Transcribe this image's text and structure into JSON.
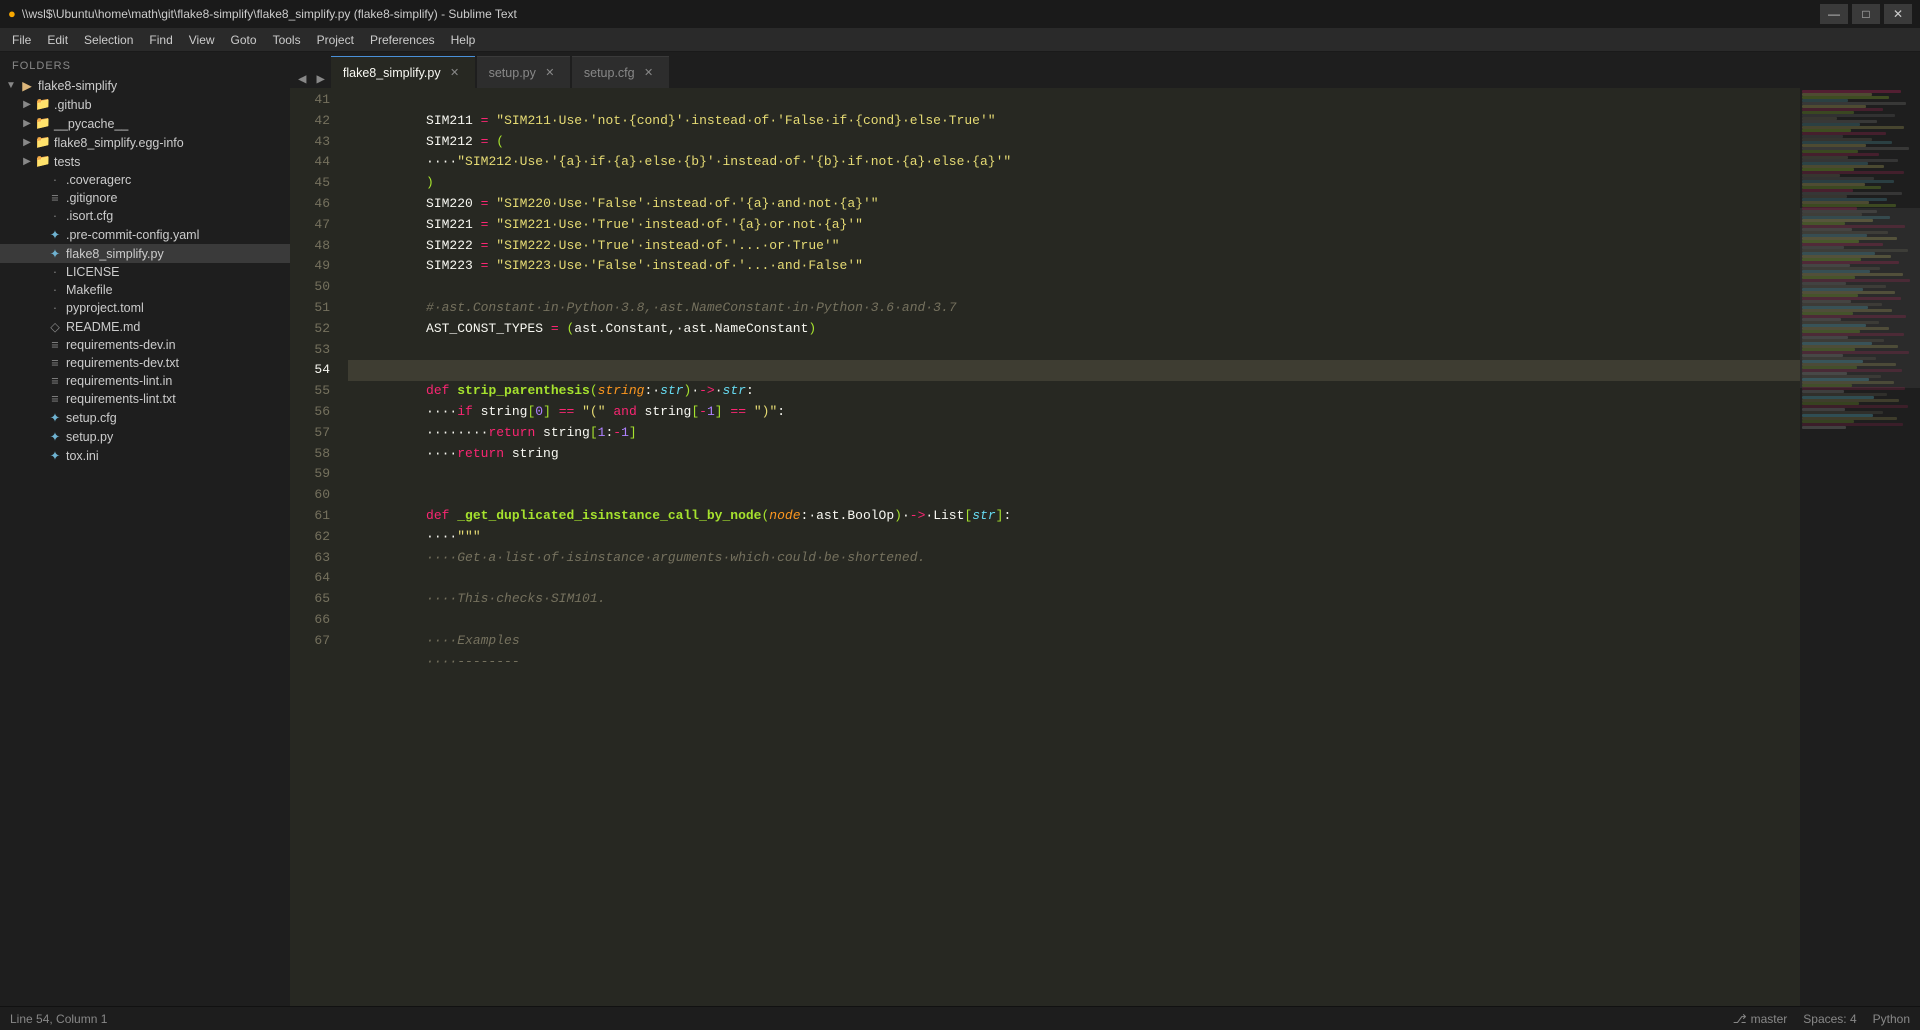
{
  "titlebar": {
    "title": "\\\\wsl$\\Ubuntu\\home\\math\\git\\flake8-simplify\\flake8_simplify.py (flake8-simplify) - Sublime Text",
    "icon": "ST",
    "minimize": "—",
    "maximize": "□",
    "close": "✕"
  },
  "menubar": {
    "items": [
      "File",
      "Edit",
      "Selection",
      "Find",
      "View",
      "Goto",
      "Tools",
      "Project",
      "Preferences",
      "Help"
    ]
  },
  "sidebar": {
    "folders_label": "FOLDERS",
    "items": [
      {
        "id": "flake8-simplify",
        "label": "flake8-simplify",
        "indent": 0,
        "type": "folder",
        "open": true,
        "expanded": true
      },
      {
        "id": "github",
        "label": ".github",
        "indent": 1,
        "type": "folder",
        "open": false,
        "expanded": false
      },
      {
        "id": "pycache",
        "label": "__pycache__",
        "indent": 1,
        "type": "folder",
        "open": false,
        "expanded": false
      },
      {
        "id": "egg-info",
        "label": "flake8_simplify.egg-info",
        "indent": 1,
        "type": "folder",
        "open": false,
        "expanded": false
      },
      {
        "id": "tests",
        "label": "tests",
        "indent": 1,
        "type": "folder",
        "open": false,
        "expanded": false
      },
      {
        "id": "coveragerc",
        "label": ".coveragerc",
        "indent": 1,
        "type": "file",
        "ext": ""
      },
      {
        "id": "gitignore",
        "label": ".gitignore",
        "indent": 1,
        "type": "file",
        "ext": ""
      },
      {
        "id": "isort",
        "label": ".isort.cfg",
        "indent": 1,
        "type": "file",
        "ext": "cfg"
      },
      {
        "id": "precommit",
        "label": ".pre-commit-config.yaml",
        "indent": 1,
        "type": "file",
        "ext": "yaml"
      },
      {
        "id": "flake8simplify",
        "label": "flake8_simplify.py",
        "indent": 1,
        "type": "file",
        "ext": "py",
        "active": true
      },
      {
        "id": "license",
        "label": "LICENSE",
        "indent": 1,
        "type": "file",
        "ext": ""
      },
      {
        "id": "makefile",
        "label": "Makefile",
        "indent": 1,
        "type": "file",
        "ext": ""
      },
      {
        "id": "pyproject",
        "label": "pyproject.toml",
        "indent": 1,
        "type": "file",
        "ext": "toml"
      },
      {
        "id": "readme",
        "label": "README.md",
        "indent": 1,
        "type": "file",
        "ext": "md"
      },
      {
        "id": "req-dev",
        "label": "requirements-dev.in",
        "indent": 1,
        "type": "file",
        "ext": "in"
      },
      {
        "id": "req-dev-txt",
        "label": "requirements-dev.txt",
        "indent": 1,
        "type": "file",
        "ext": "txt"
      },
      {
        "id": "req-lint",
        "label": "requirements-lint.in",
        "indent": 1,
        "type": "file",
        "ext": "in"
      },
      {
        "id": "req-lint-txt",
        "label": "requirements-lint.txt",
        "indent": 1,
        "type": "file",
        "ext": "txt"
      },
      {
        "id": "setup-cfg",
        "label": "setup.cfg",
        "indent": 1,
        "type": "file",
        "ext": "cfg"
      },
      {
        "id": "setup-py",
        "label": "setup.py",
        "indent": 1,
        "type": "file",
        "ext": "py"
      },
      {
        "id": "tox",
        "label": "tox.ini",
        "indent": 1,
        "type": "file",
        "ext": "ini"
      }
    ]
  },
  "tabs": [
    {
      "label": "flake8_simplify.py",
      "active": true,
      "modified": false
    },
    {
      "label": "setup.py",
      "active": false,
      "modified": false
    },
    {
      "label": "setup.cfg",
      "active": false,
      "modified": false
    }
  ],
  "statusbar": {
    "line": "Line 54, Column 1",
    "branch": "master",
    "spaces": "Spaces: 4",
    "language": "Python"
  },
  "lines": {
    "start": 41,
    "active": 54
  }
}
